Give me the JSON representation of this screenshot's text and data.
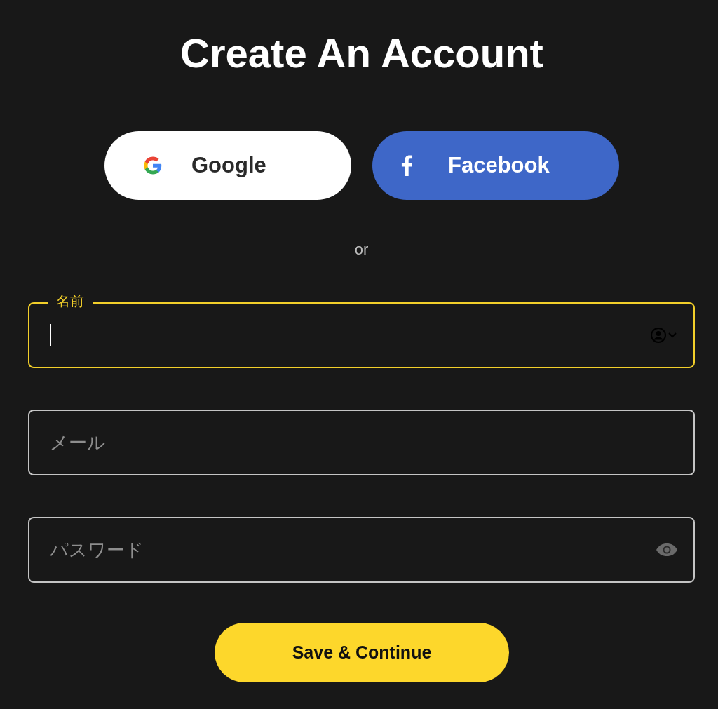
{
  "title": "Create An Account",
  "social_buttons": [
    {
      "kind": "google",
      "label": "Google"
    },
    {
      "kind": "facebook",
      "label": "Facebook"
    }
  ],
  "divider": "or",
  "fields": [
    {
      "kind": "name",
      "label": "名前",
      "focused": true
    },
    {
      "kind": "email",
      "placeholder": "メール",
      "focused": false
    },
    {
      "kind": "password",
      "placeholder": "パスワード",
      "focused": false
    }
  ],
  "submit": "Save & Continue"
}
